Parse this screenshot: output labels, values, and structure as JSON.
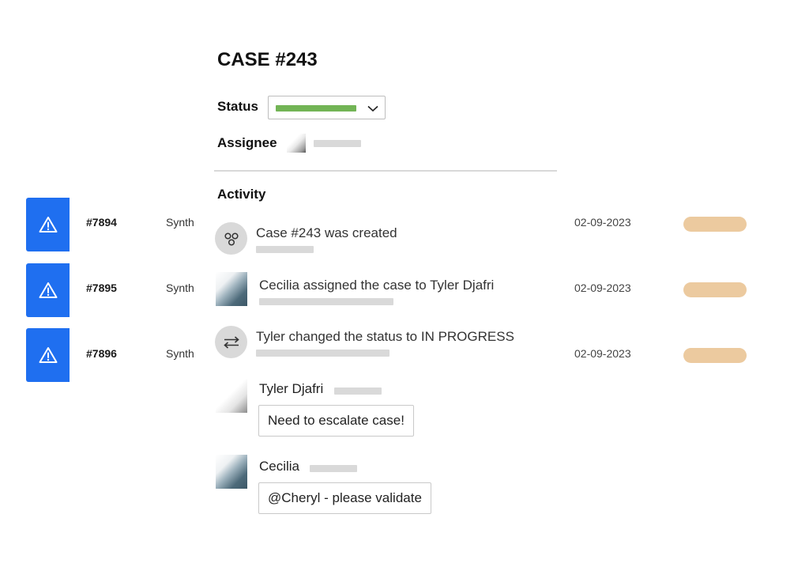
{
  "case": {
    "title": "CASE #243",
    "status_label": "Status",
    "status_color": "#72b455",
    "assignee_label": "Assignee",
    "activity_label": "Activity"
  },
  "alerts": [
    {
      "id": "#7894",
      "source": "Synth",
      "date": "02-09-2023",
      "icon": "warning-icon",
      "pill_color": "#ecca9f"
    },
    {
      "id": "#7895",
      "source": "Synth",
      "date": "02-09-2023",
      "icon": "warning-icon",
      "pill_color": "#ecca9f"
    },
    {
      "id": "#7896",
      "source": "Synth",
      "date": "02-09-2023",
      "icon": "warning-icon",
      "pill_color": "#ecca9f"
    }
  ],
  "activity": [
    {
      "text": "Case #243 was created",
      "icon": "case-nodes-icon"
    },
    {
      "text": "Cecilia assigned the case to Tyler Djafri",
      "icon": "avatar"
    },
    {
      "text": "Tyler changed the status to IN PROGRESS",
      "icon": "swap-arrows-icon"
    }
  ],
  "comments": [
    {
      "author": "Tyler Djafri",
      "text": "Need to escalate case!"
    },
    {
      "author": "Cecilia",
      "text": "@Cheryl - please validate"
    }
  ],
  "colors": {
    "alert_blue": "#1f6ff0",
    "placeholder_gray": "#d9d9d9"
  }
}
